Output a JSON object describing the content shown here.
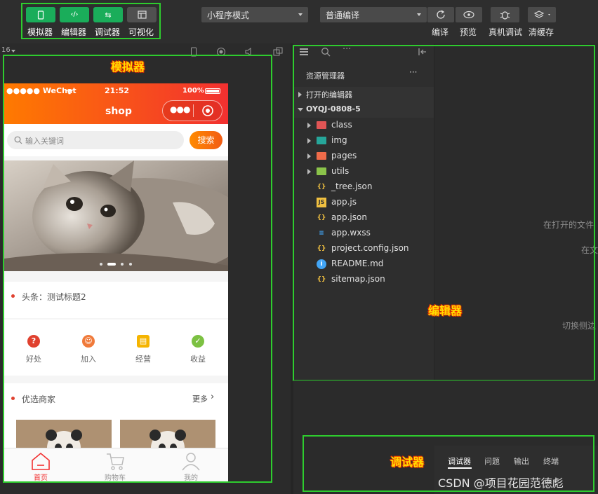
{
  "toolbar": {
    "modes": [
      {
        "label": "模拟器",
        "icon": "phone-icon"
      },
      {
        "label": "编辑器",
        "icon": "code-icon"
      },
      {
        "label": "调试器",
        "icon": "swap-icon"
      },
      {
        "label": "可视化",
        "icon": "layout-icon"
      }
    ],
    "mode_select": "小程序模式",
    "compile_select": "普通编译",
    "actions": [
      "编译",
      "预览",
      "真机调试",
      "清缓存"
    ]
  },
  "zoom": "16",
  "annotations": {
    "simulator": "模拟器",
    "editor": "编辑器",
    "debugger": "调试器"
  },
  "phone": {
    "carrier": "●●●●● WeChat",
    "time": "21:52",
    "battery": "100%",
    "title": "shop",
    "search_placeholder": "输入关键词",
    "search_button": "搜索",
    "headline": "头条：测试标题2",
    "grid": [
      {
        "label": "好处",
        "icon": "question-icon",
        "color": "#e0412f"
      },
      {
        "label": "加入",
        "icon": "people-icon",
        "color": "#f07a3a"
      },
      {
        "label": "经营",
        "icon": "shop-icon",
        "color": "#f5b400"
      },
      {
        "label": "收益",
        "icon": "leaf-icon",
        "color": "#7cc142"
      }
    ],
    "section_title": "优选商家",
    "section_more": "更多",
    "tabs": [
      {
        "label": "首页",
        "active": true
      },
      {
        "label": "购物车",
        "active": false
      },
      {
        "label": "我的",
        "active": false
      }
    ],
    "accent": "#f23030"
  },
  "explorer": {
    "title": "资源管理器",
    "open_editors": "打开的编辑器",
    "project": "OYQJ-0808-5",
    "folders": [
      {
        "name": "class",
        "color": "#e05555"
      },
      {
        "name": "img",
        "color": "#26a69a"
      },
      {
        "name": "pages",
        "color": "#ef6c4a"
      },
      {
        "name": "utils",
        "color": "#8bc34a"
      }
    ],
    "files": [
      {
        "name": "_tree.json",
        "icon": "json-icon"
      },
      {
        "name": "app.js",
        "icon": "js-icon"
      },
      {
        "name": "app.json",
        "icon": "json-icon"
      },
      {
        "name": "app.wxss",
        "icon": "css-icon"
      },
      {
        "name": "project.config.json",
        "icon": "json-icon"
      },
      {
        "name": "README.md",
        "icon": "info-icon"
      },
      {
        "name": "sitemap.json",
        "icon": "json-icon"
      }
    ]
  },
  "editor_hints": [
    "在打开的文件",
    "在文",
    "切换侧边"
  ],
  "debugger": {
    "tabs": [
      "调试器",
      "问题",
      "输出",
      "终端"
    ]
  },
  "watermark": "CSDN @项目花园范德彪"
}
